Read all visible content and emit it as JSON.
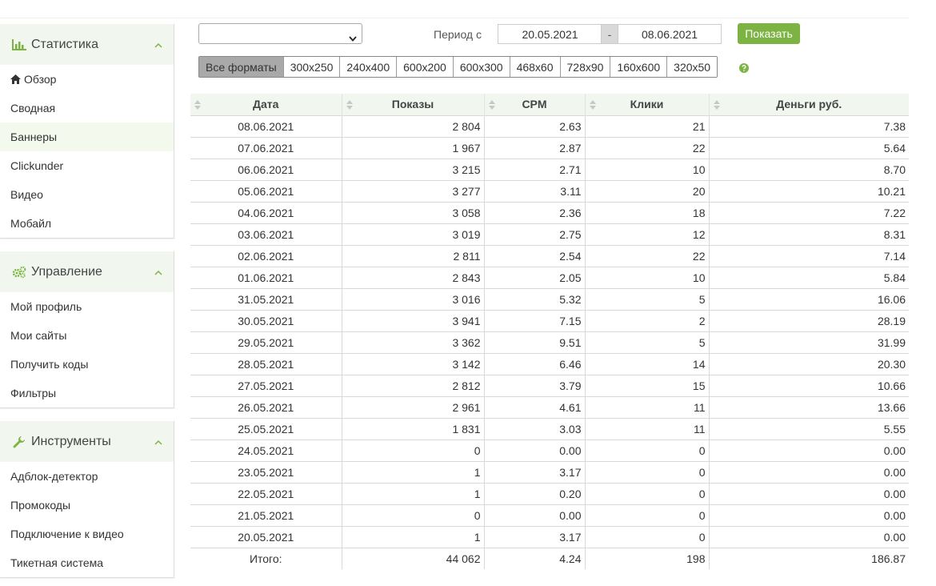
{
  "sidebar": {
    "stats": {
      "title": "Статистика",
      "items": [
        {
          "label": "Обзор",
          "icon": "home-icon"
        },
        {
          "label": "Сводная"
        },
        {
          "label": "Баннеры",
          "active": true
        },
        {
          "label": "Clickunder"
        },
        {
          "label": "Видео"
        },
        {
          "label": "Мобайл"
        }
      ]
    },
    "manage": {
      "title": "Управление",
      "items": [
        {
          "label": "Мой профиль"
        },
        {
          "label": "Мои сайты"
        },
        {
          "label": "Получить коды"
        },
        {
          "label": "Фильтры"
        }
      ]
    },
    "tools": {
      "title": "Инструменты",
      "items": [
        {
          "label": "Адблок-детектор"
        },
        {
          "label": "Промокоды"
        },
        {
          "label": "Подключение к видео"
        },
        {
          "label": "Тикетная система"
        }
      ]
    }
  },
  "filters": {
    "select_value": "",
    "period_label": "Период с",
    "date_from": "20.05.2021",
    "date_sep": "-",
    "date_to": "08.06.2021",
    "show_label": "Показать",
    "formats": [
      "Все форматы",
      "300x250",
      "240x400",
      "600x200",
      "600x300",
      "468x60",
      "728x90",
      "160x600",
      "320x50"
    ],
    "active_format": "Все форматы"
  },
  "colors": {
    "accent": "#7cb342",
    "header_bg": "#f1f7ef"
  },
  "table": {
    "headers": [
      "Дата",
      "Показы",
      "CPM",
      "Клики",
      "Деньги руб."
    ],
    "rows": [
      [
        "08.06.2021",
        "2 804",
        "2.63",
        "21",
        "7.38"
      ],
      [
        "07.06.2021",
        "1 967",
        "2.87",
        "22",
        "5.64"
      ],
      [
        "06.06.2021",
        "3 215",
        "2.71",
        "10",
        "8.70"
      ],
      [
        "05.06.2021",
        "3 277",
        "3.11",
        "20",
        "10.21"
      ],
      [
        "04.06.2021",
        "3 058",
        "2.36",
        "18",
        "7.22"
      ],
      [
        "03.06.2021",
        "3 019",
        "2.75",
        "12",
        "8.31"
      ],
      [
        "02.06.2021",
        "2 811",
        "2.54",
        "22",
        "7.14"
      ],
      [
        "01.06.2021",
        "2 843",
        "2.05",
        "10",
        "5.84"
      ],
      [
        "31.05.2021",
        "3 016",
        "5.32",
        "5",
        "16.06"
      ],
      [
        "30.05.2021",
        "3 941",
        "7.15",
        "2",
        "28.19"
      ],
      [
        "29.05.2021",
        "3 362",
        "9.51",
        "5",
        "31.99"
      ],
      [
        "28.05.2021",
        "3 142",
        "6.46",
        "14",
        "20.30"
      ],
      [
        "27.05.2021",
        "2 812",
        "3.79",
        "15",
        "10.66"
      ],
      [
        "26.05.2021",
        "2 961",
        "4.61",
        "11",
        "13.66"
      ],
      [
        "25.05.2021",
        "1 831",
        "3.03",
        "11",
        "5.55"
      ],
      [
        "24.05.2021",
        "0",
        "0.00",
        "0",
        "0.00"
      ],
      [
        "23.05.2021",
        "1",
        "3.17",
        "0",
        "0.00"
      ],
      [
        "22.05.2021",
        "1",
        "0.20",
        "0",
        "0.00"
      ],
      [
        "21.05.2021",
        "0",
        "0.00",
        "0",
        "0.00"
      ],
      [
        "20.05.2021",
        "1",
        "3.17",
        "0",
        "0.00"
      ]
    ],
    "total": [
      "Итого:",
      "44 062",
      "4.24",
      "198",
      "186.87"
    ]
  }
}
